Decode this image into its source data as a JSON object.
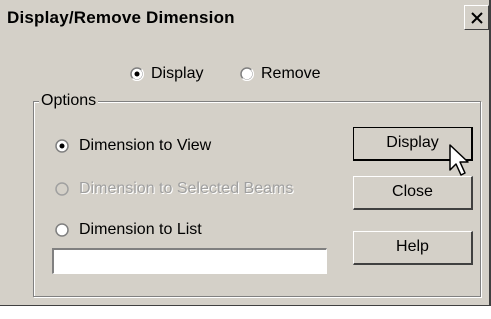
{
  "window": {
    "title": "Display/Remove Dimension",
    "close_symbol": "✕"
  },
  "mode": {
    "display_label": "Display",
    "remove_label": "Remove",
    "selected": "Display"
  },
  "options": {
    "group_label": "Options",
    "dimension_to_view_label": "Dimension to View",
    "dimension_to_selected_beams_label": "Dimension to Selected Beams",
    "dimension_to_list_label": "Dimension to List",
    "selected": "Dimension to View",
    "list_value": ""
  },
  "buttons": {
    "display_label": "Display",
    "close_label": "Close",
    "help_label": "Help"
  },
  "icons": {
    "close": "close-icon",
    "cursor": "mouse-pointer-icon"
  }
}
